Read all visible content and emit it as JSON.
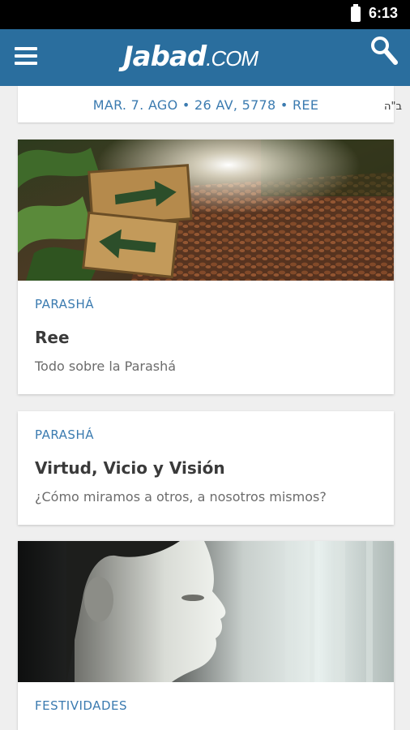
{
  "status_bar": {
    "time": "6:13",
    "battery_icon": "battery-icon"
  },
  "app_bar": {
    "logo_main": "Jabad",
    "logo_sub": ".COM",
    "menu_icon": "hamburger-menu-icon",
    "search_icon": "search-icon",
    "color": "#2a6e9e"
  },
  "date_bar": {
    "text": "MAR. 7. AGO • 26 AV, 5778 • REE",
    "bh": "ב\"ה"
  },
  "cards": [
    {
      "category": "PARASHÁ",
      "title": "Ree",
      "subtitle": "Todo sobre la Parashá"
    },
    {
      "category": "PARASHÁ",
      "title": "Virtud, Vicio y Visión",
      "subtitle": "¿Cómo miramos a otros, a nosotros mismos?"
    },
    {
      "category": "FESTIVIDADES"
    }
  ],
  "colors": {
    "accent": "#3b7bb0",
    "background": "#efefef"
  }
}
